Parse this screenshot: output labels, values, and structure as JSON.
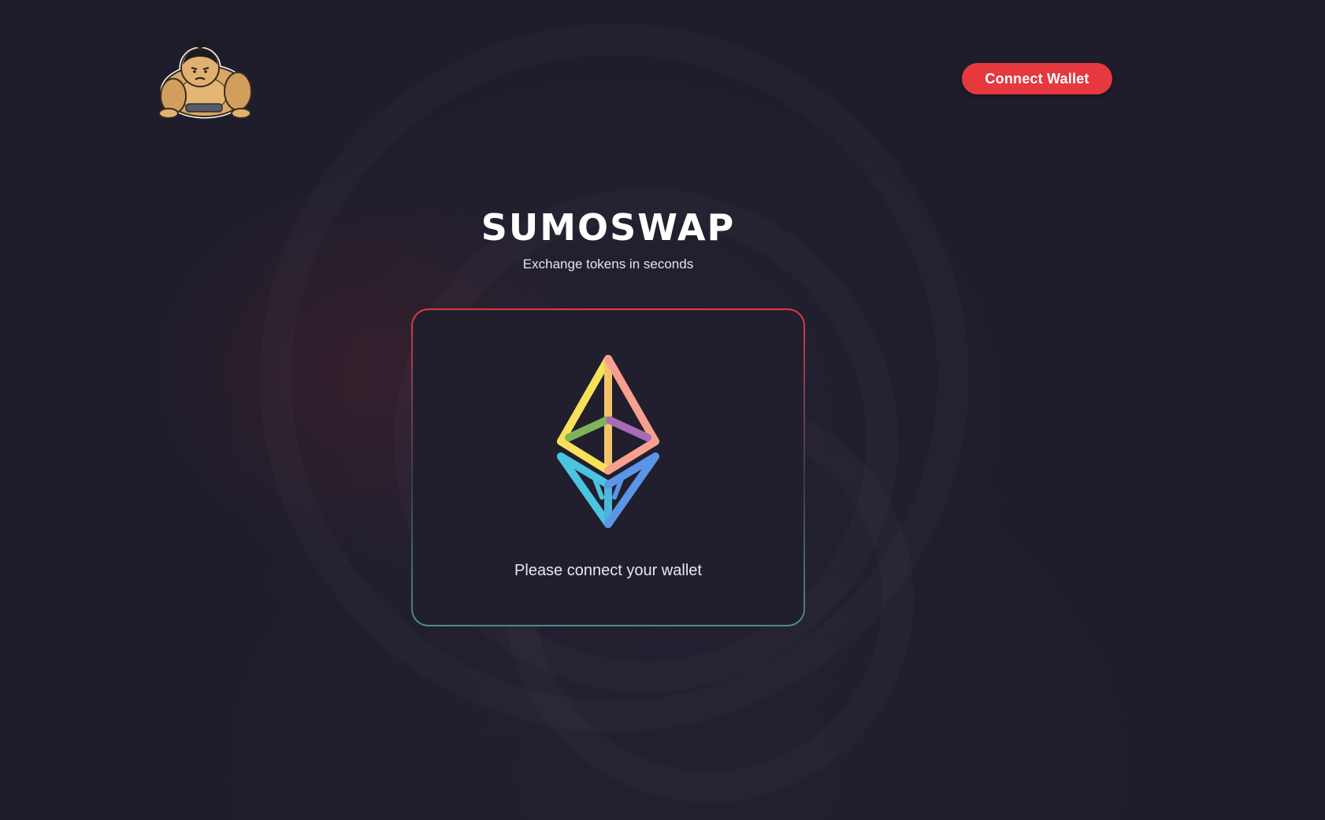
{
  "header": {
    "logo_icon": "sumo-wrestler-logo",
    "connect_button_label": "Connect Wallet"
  },
  "hero": {
    "title": "SUMOSWAP",
    "subtitle": "Exchange tokens in seconds"
  },
  "card": {
    "icon": "ethereum-icon",
    "message": "Please connect your wallet"
  },
  "colors": {
    "background": "#1f1d2b",
    "accent": "#e5383f",
    "card_background": "#211f2d"
  }
}
